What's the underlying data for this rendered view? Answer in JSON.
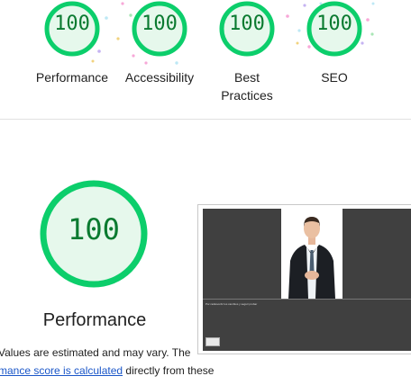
{
  "summary": {
    "gauges": [
      {
        "score": "100",
        "label": "Performance"
      },
      {
        "score": "100",
        "label": "Accessibility"
      },
      {
        "score": "100",
        "label": "Best Practices"
      },
      {
        "score": "100",
        "label": "SEO"
      }
    ]
  },
  "performance": {
    "score": "100",
    "title": "Performance",
    "desc_line1": "Values are estimated and may vary. The",
    "desc_link": "mance score is calculated",
    "desc_after_link": " directly from these",
    "screenshot_caption": "Por radiosonbr los cambios y seguir probar"
  },
  "colors": {
    "pass_ring": "#0cce6b",
    "pass_fill": "#e6f8ec",
    "pass_text": "#0a7a30",
    "link": "#1a56c8"
  }
}
